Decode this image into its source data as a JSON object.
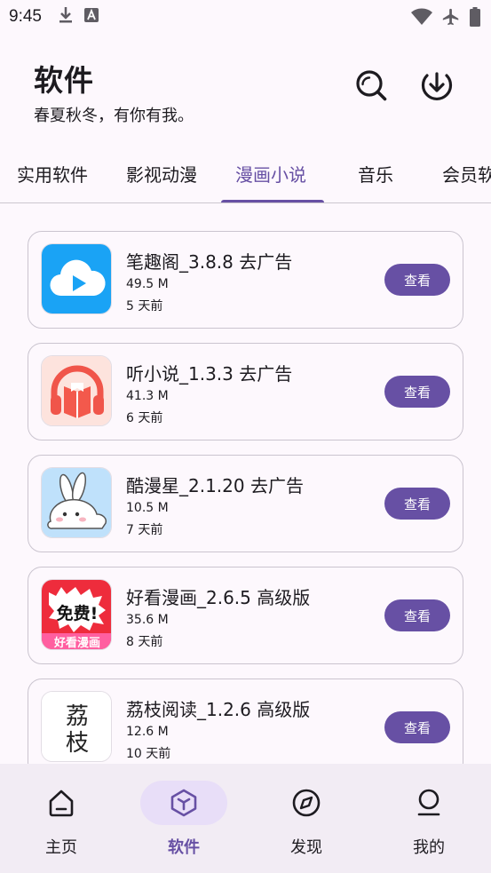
{
  "status_bar": {
    "time": "9:45",
    "icons": [
      "download-icon",
      "a-icon",
      "wifi-icon",
      "airplane-icon",
      "battery-icon"
    ]
  },
  "header": {
    "title": "软件",
    "subtitle": "春夏秋冬，有你有我。",
    "actions": [
      "search-icon",
      "download-icon"
    ]
  },
  "tabs": [
    {
      "label": "实用软件",
      "active": false
    },
    {
      "label": "影视动漫",
      "active": false
    },
    {
      "label": "漫画小说",
      "active": true
    },
    {
      "label": "音乐",
      "active": false
    },
    {
      "label": "会员软",
      "active": false
    }
  ],
  "apps": [
    {
      "title": "笔趣阁_3.8.8 去广告",
      "size": "49.5 M",
      "date": "5 天前",
      "button": "查看",
      "icon": "cloud-play-icon"
    },
    {
      "title": "听小说_1.3.3 去广告",
      "size": "41.3 M",
      "date": "6 天前",
      "button": "查看",
      "icon": "headphones-book-icon"
    },
    {
      "title": "酷漫星_2.1.20 去广告",
      "size": "10.5 M",
      "date": "7 天前",
      "button": "查看",
      "icon": "rabbit-icon"
    },
    {
      "title": "好看漫画_2.6.5 高级版",
      "size": "35.6 M",
      "date": "8 天前",
      "button": "查看",
      "icon": "free-manga-icon",
      "icon_text_main": "免费!",
      "icon_text_sub": "好看漫画"
    },
    {
      "title": "荔枝阅读_1.2.6 高级版",
      "size": "12.6 M",
      "date": "10 天前",
      "button": "查看",
      "icon": "lizhi-calligraphy-icon",
      "icon_text": "荔枝"
    }
  ],
  "bottom_nav": [
    {
      "label": "主页",
      "icon": "home-icon",
      "active": false
    },
    {
      "label": "软件",
      "icon": "cube-icon",
      "active": true
    },
    {
      "label": "发现",
      "icon": "compass-icon",
      "active": false
    },
    {
      "label": "我的",
      "icon": "person-icon",
      "active": false
    }
  ],
  "colors": {
    "accent": "#6750a4",
    "background": "#fdf8fd",
    "nav_background": "#f2ecf4",
    "nav_active_pill": "#e8def8"
  }
}
